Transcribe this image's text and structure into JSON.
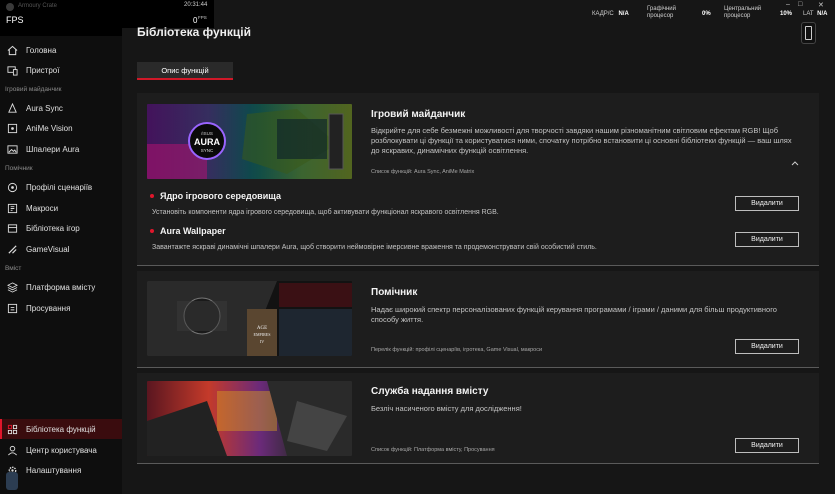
{
  "app": {
    "name": "Armoury Crate",
    "fps_label": "FPS"
  },
  "overlay": {
    "clock": "20:31:44",
    "fps_value": "0",
    "fps_unit": "FPS",
    "kadr_label": "КАДР/С",
    "kadr_value": "N/A",
    "gpu_label_1": "Графічний",
    "gpu_label_2": "процесор",
    "gpu_value": "0%",
    "cpu_label_1": "Центральний",
    "cpu_label_2": "процесор",
    "cpu_value": "10%",
    "lat_label": "LAT",
    "lat_value": "N/A"
  },
  "sidebar": {
    "items_main": [
      {
        "label": "Головна",
        "icon": "home-icon"
      },
      {
        "label": "Пристрої",
        "icon": "devices-icon"
      }
    ],
    "section_gaming": "Ігровий майданчик",
    "items_gaming": [
      {
        "label": "Aura Sync",
        "icon": "aura-icon"
      },
      {
        "label": "AniMe Vision",
        "icon": "anime-icon"
      },
      {
        "label": "Шпалери Aura",
        "icon": "wallpaper-icon"
      }
    ],
    "section_helper": "Помічник",
    "items_helper": [
      {
        "label": "Профілі сценаріїв",
        "icon": "profile-icon"
      },
      {
        "label": "Макроси",
        "icon": "macro-icon"
      },
      {
        "label": "Бібліотека ігор",
        "icon": "game-library-icon"
      },
      {
        "label": "GameVisual",
        "icon": "gamevisual-icon"
      }
    ],
    "section_content": "Вміст",
    "items_content": [
      {
        "label": "Платформа вмісту",
        "icon": "content-platform-icon"
      },
      {
        "label": "Просування",
        "icon": "promotion-icon"
      }
    ],
    "items_bottom": [
      {
        "label": "Бібліотека функцій",
        "icon": "function-library-icon",
        "active": true
      },
      {
        "label": "Центр користувача",
        "icon": "user-center-icon"
      },
      {
        "label": "Налаштування",
        "icon": "settings-icon"
      }
    ]
  },
  "main": {
    "title": "Бібліотека функцій",
    "tab": "Опис функцій",
    "cards": [
      {
        "title": "Ігровий майданчик",
        "desc": "Відкрийте для себе безмежні можливості для творчості завдяки нашим різноманітним світловим ефектам RGB! Щоб розблокувати ці функції та користуватися ними, спочатку потрібно встановити ці основні бібліотеки функцій — ваш шлях до яскравих, динамічних функцій освітлення.",
        "list": "Список функцій: Aura Sync, AniMe Matrix",
        "subs": [
          {
            "title": "Ядро ігрового середовища",
            "desc": "Установіть компоненти ядра ігрового середовища, щоб активувати функціонал яскравого освітлення RGB.",
            "button": "Видалити"
          },
          {
            "title": "Aura Wallpaper",
            "desc": "Завантажте яскраві динамічні шпалери Aura, щоб створити неймовірне імерсивне враження та продемонструвати свій особистий стиль.",
            "button": "Видалити"
          }
        ]
      },
      {
        "title": "Помічник",
        "desc": "Надає широкий спектр персоналізованих функцій керування програмами / іграми / даними для більш продуктивного способу життя.",
        "list": "Перелік функцій: профілі сценаріїв, ігротека, Game Visual, макроси",
        "button": "Видалити",
        "thumb_text": [
          "AGE",
          "EMPIRES",
          "IV"
        ]
      },
      {
        "title": "Служба надання вмісту",
        "desc": "Безліч насиченого вмісту для дослідження!",
        "list": "Список функцій: Платформа вмісту, Просування",
        "button": "Видалити"
      }
    ]
  },
  "thumb1": {
    "logo": "/ISUS",
    "aura": "AURA",
    "sync": "SYNC"
  },
  "colors": {
    "accent": "#e0162b",
    "background": "#161616",
    "card": "#1d1d1d",
    "sidebar": "#0e0e0e"
  }
}
